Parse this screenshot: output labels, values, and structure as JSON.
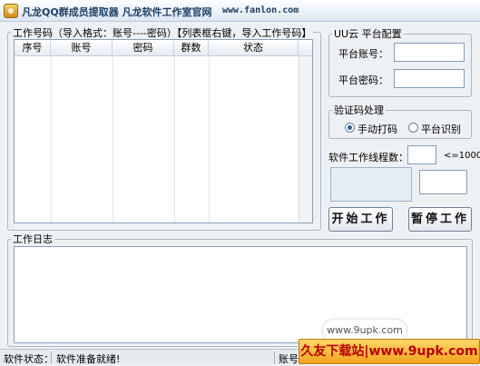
{
  "window": {
    "title": "凡龙QQ群成员提取器 凡龙软件工作室官网",
    "website": "www.fanlon.com"
  },
  "work_accounts": {
    "group_title": "工作号码（导入格式：账号----密码）【列表框右键，导入工作号码】",
    "columns": [
      "序号",
      "账号",
      "密码",
      "群数",
      "状态"
    ]
  },
  "cloud_config": {
    "group_title": "UU云 平台配置",
    "account_label": "平台账号：",
    "account_value": "",
    "password_label": "平台密码：",
    "password_value": ""
  },
  "captcha": {
    "group_title": "验证码处理",
    "option_manual": "手动打码",
    "option_platform": "平台识别",
    "selected": "手动打码"
  },
  "threads": {
    "label": "软件工作线程数：",
    "value": "",
    "hint": "<=1000"
  },
  "buttons": {
    "start": "开始工作",
    "pause": "暂停工作"
  },
  "log": {
    "group_title": "工作日志",
    "content": ""
  },
  "status_bar": {
    "label": "软件状态：",
    "message": "软件准备就绪!",
    "account_label": "账号"
  },
  "watermark": {
    "cloud_text": "www.9upk.com",
    "banner_text": "久友下载站|www.9upk.com"
  },
  "colors": {
    "title_text": "#1f3f63",
    "window_bg": "#eef1f4",
    "border": "#a9b9c9",
    "watermark_red": "#b80000",
    "watermark_orange": "#f2a41d"
  }
}
